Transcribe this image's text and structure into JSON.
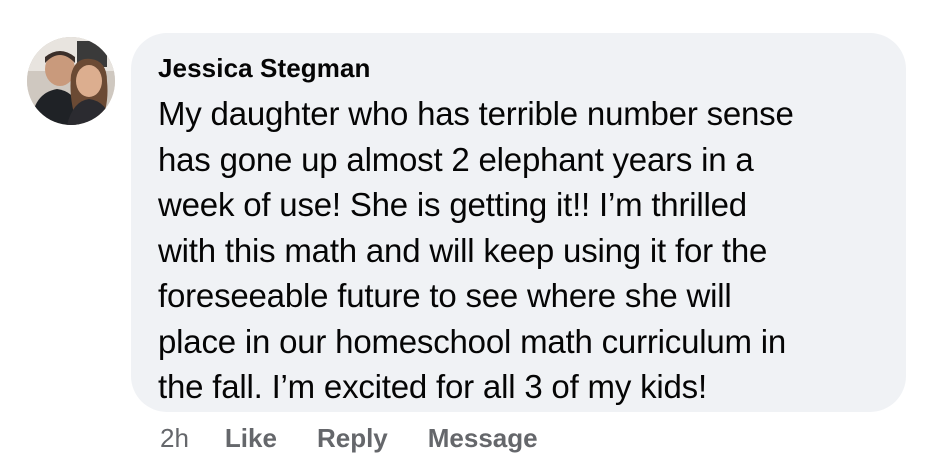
{
  "comment": {
    "author": "Jessica Stegman",
    "text": "My daughter who has terrible number sense\nhas gone up almost 2 elephant years in a\nweek of use! She is getting it!! I’m thrilled\nwith this math and will keep using it for the\nforeseeable future to see where she will\nplace in our homeschool math curriculum in\nthe fall. I’m excited for all 3 of my kids!",
    "timestamp": "2h",
    "actions": {
      "like_label": "Like",
      "reply_label": "Reply",
      "message_label": "Message"
    }
  },
  "colors": {
    "bubble_background": "#f0f2f5",
    "text_primary": "#050505",
    "text_secondary": "#65676b"
  }
}
